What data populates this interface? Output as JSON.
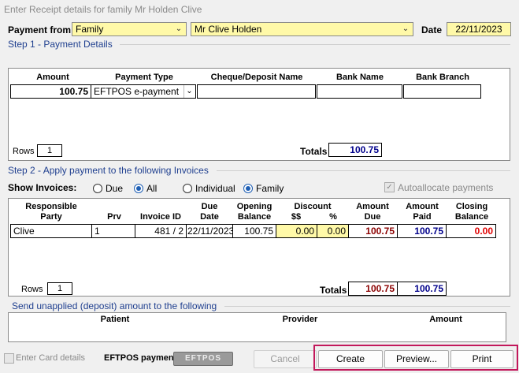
{
  "window_title": "Enter Receipt details for family Mr  Holden  Clive",
  "header": {
    "payment_from_label": "Payment from",
    "payment_from_type": "Family",
    "payment_from_name": "Mr Clive  Holden",
    "date_label": "Date",
    "date_value": "22/11/2023"
  },
  "step1": {
    "title": "Step 1 - Payment Details",
    "columns": [
      "Amount",
      "Payment Type",
      "Cheque/Deposit Name",
      "Bank Name",
      "Bank Branch"
    ],
    "row": {
      "amount": "100.75",
      "payment_type": "EFTPOS e-payment",
      "cheque_name": "",
      "bank_name": "",
      "bank_branch": ""
    },
    "rows_label": "Rows",
    "rows_value": "1",
    "totals_label": "Totals",
    "totals_value": "100.75"
  },
  "step2": {
    "title": "Step 2 - Apply payment to the following Invoices",
    "show_invoices_label": "Show Invoices:",
    "radio_due": "Due",
    "radio_all": "All",
    "radio_individual": "Individual",
    "radio_family": "Family",
    "autoallocate_label": "Autoallocate payments",
    "columns": {
      "party": "Responsible\nParty",
      "prv": "Prv",
      "invoice_id": "Invoice ID",
      "due_date": "Due\nDate",
      "opening_balance": "Opening\nBalance",
      "discount": "Discount",
      "discount_dollar": "$$",
      "discount_pct": "%",
      "amount_due": "Amount\nDue",
      "amount_paid": "Amount\nPaid",
      "closing_balance": "Closing\nBalance"
    },
    "row": {
      "party": "Clive",
      "prv": "1",
      "invoice_id": "481 / 2",
      "due_date": "22/11/2023",
      "opening_balance": "100.75",
      "discount_dollar": "0.00",
      "discount_pct": "0.00",
      "amount_due": "100.75",
      "amount_paid": "100.75",
      "closing_balance": "0.00"
    },
    "rows_label": "Rows",
    "rows_value": "1",
    "totals_label": "Totals",
    "totals_due": "100.75",
    "totals_paid": "100.75"
  },
  "unapplied": {
    "title": "Send unapplied (deposit) amount to the following",
    "columns": [
      "Patient",
      "Provider",
      "Amount"
    ]
  },
  "footer": {
    "enter_card_label": "Enter Card details",
    "eftpos_label": "EFTPOS payment",
    "eftpos_logo": "EFTPOS",
    "cancel": "Cancel",
    "create": "Create",
    "preview": "Preview...",
    "print": "Print"
  },
  "colors": {
    "highlight_border": "#c2185b",
    "combo_bg": "#fff9a8",
    "legend_text": "#1f3f8f"
  }
}
